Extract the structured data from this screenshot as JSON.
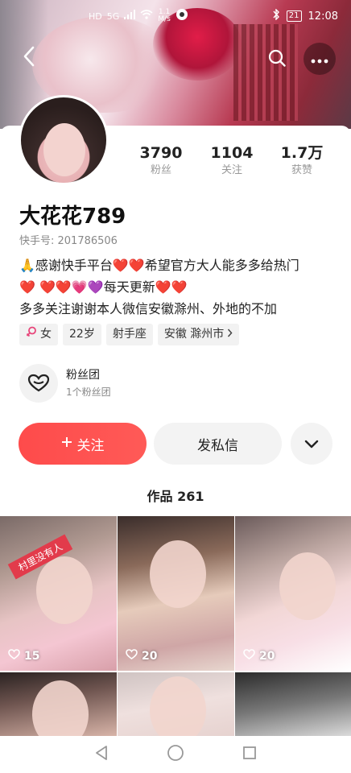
{
  "status_bar": {
    "hd": "HD",
    "network": "5G",
    "speed_value": "1.1",
    "speed_unit": "M/s",
    "battery": "21",
    "time": "12:08"
  },
  "header": {
    "back_icon": "chevron-left-icon",
    "search_icon": "search-icon",
    "more_icon": "more-horizontal-icon"
  },
  "profile": {
    "username": "大花花789",
    "kuaishou_id_label": "快手号: 201786506",
    "stats": [
      {
        "value": "3790",
        "label": "粉丝"
      },
      {
        "value": "1104",
        "label": "关注"
      },
      {
        "value": "1.7万",
        "label": "获赞"
      }
    ],
    "bio_lines": [
      "🙏感谢快手平台❤️❤️希望官方大人能多多给热门",
      "❤️                    ❤️❤️💗💜每天更新❤️❤️",
      "多多关注谢谢本人微信安徽滁州、外地的不加"
    ],
    "tags": {
      "gender": "女",
      "age": "22岁",
      "zodiac": "射手座",
      "location": "安徽 滁州市"
    }
  },
  "fan_group": {
    "title": "粉丝团",
    "subtitle": "1个粉丝团"
  },
  "actions": {
    "follow_label": "关注",
    "message_label": "发私信"
  },
  "works": {
    "title": "作品 261",
    "items": [
      {
        "likes": "15",
        "ribbon": "村里没有人"
      },
      {
        "likes": "20"
      },
      {
        "likes": "20"
      },
      {},
      {},
      {}
    ]
  },
  "colors": {
    "accent": "#fe4b4b",
    "secondary_bg": "#f3f3f3",
    "muted_text": "#999999"
  }
}
